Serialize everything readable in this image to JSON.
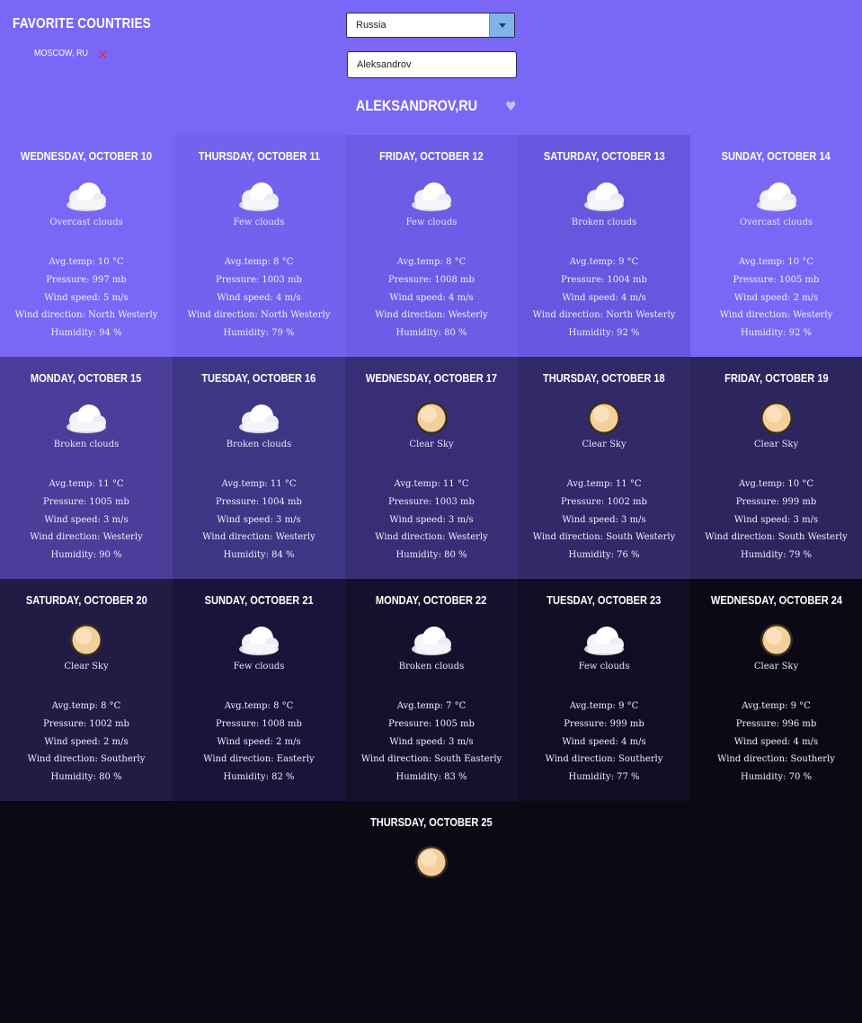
{
  "favorites": {
    "title": "FAVORITE COUNTRIES",
    "items": [
      {
        "label": "MOSCOW, RU",
        "remove": "✕"
      }
    ]
  },
  "search": {
    "country_selected": "Russia",
    "city_value": "Aleksandrov"
  },
  "location": {
    "title": "ALEKSANDROV,RU",
    "heart": "♥"
  },
  "labels": {
    "avg_temp": "Avg.temp:",
    "pressure": "Pressure:",
    "wind_speed": "Wind speed:",
    "wind_direction": "Wind direction:",
    "humidity": "Humidity:"
  },
  "icons": {
    "cloud": "cloud-icon",
    "sun": "clear-sky-icon"
  },
  "colors": {
    "header": "#7b67f6",
    "text": "#ffffff",
    "remove": "#e0245e",
    "dropdown_button": "#7fb3ea"
  },
  "days": [
    {
      "date": "WEDNESDAY, OCTOBER 10",
      "icon": "cloud",
      "desc": "Overcast clouds",
      "temp": "10 °C",
      "pressure": "997 mb",
      "wind_speed": "5 m/s",
      "wind_dir": "North Westerly",
      "humidity": "94 %"
    },
    {
      "date": "THURSDAY, OCTOBER 11",
      "icon": "cloud",
      "desc": "Few clouds",
      "temp": "8 °C",
      "pressure": "1003 mb",
      "wind_speed": "4 m/s",
      "wind_dir": "North Westerly",
      "humidity": "79 %"
    },
    {
      "date": "FRIDAY, OCTOBER 12",
      "icon": "cloud",
      "desc": "Few clouds",
      "temp": "8 °C",
      "pressure": "1008 mb",
      "wind_speed": "4 m/s",
      "wind_dir": "Westerly",
      "humidity": "80 %"
    },
    {
      "date": "SATURDAY, OCTOBER 13",
      "icon": "cloud",
      "desc": "Broken clouds",
      "temp": "9 °C",
      "pressure": "1004 mb",
      "wind_speed": "4 m/s",
      "wind_dir": "North Westerly",
      "humidity": "92 %"
    },
    {
      "date": "SUNDAY, OCTOBER 14",
      "icon": "cloud",
      "desc": "Overcast clouds",
      "temp": "10 °C",
      "pressure": "1005 mb",
      "wind_speed": "2 m/s",
      "wind_dir": "Westerly",
      "humidity": "92 %"
    },
    {
      "date": "MONDAY, OCTOBER 15",
      "icon": "cloud",
      "desc": "Broken clouds",
      "temp": "11 °C",
      "pressure": "1005 mb",
      "wind_speed": "3 m/s",
      "wind_dir": "Westerly",
      "humidity": "90 %"
    },
    {
      "date": "TUESDAY, OCTOBER 16",
      "icon": "cloud",
      "desc": "Broken clouds",
      "temp": "11 °C",
      "pressure": "1004 mb",
      "wind_speed": "3 m/s",
      "wind_dir": "Westerly",
      "humidity": "84 %"
    },
    {
      "date": "WEDNESDAY, OCTOBER 17",
      "icon": "sun",
      "desc": "Clear Sky",
      "temp": "11 °C",
      "pressure": "1003 mb",
      "wind_speed": "3 m/s",
      "wind_dir": "Westerly",
      "humidity": "80 %"
    },
    {
      "date": "THURSDAY, OCTOBER 18",
      "icon": "sun",
      "desc": "Clear Sky",
      "temp": "11 °C",
      "pressure": "1002 mb",
      "wind_speed": "3 m/s",
      "wind_dir": "South Westerly",
      "humidity": "76 %"
    },
    {
      "date": "FRIDAY, OCTOBER 19",
      "icon": "sun",
      "desc": "Clear Sky",
      "temp": "10 °C",
      "pressure": "999 mb",
      "wind_speed": "3 m/s",
      "wind_dir": "South Westerly",
      "humidity": "79 %"
    },
    {
      "date": "SATURDAY, OCTOBER 20",
      "icon": "sun",
      "desc": "Clear Sky",
      "temp": "8 °C",
      "pressure": "1002 mb",
      "wind_speed": "2 m/s",
      "wind_dir": "Southerly",
      "humidity": "80 %"
    },
    {
      "date": "SUNDAY, OCTOBER 21",
      "icon": "cloud",
      "desc": "Few clouds",
      "temp": "8 °C",
      "pressure": "1008 mb",
      "wind_speed": "2 m/s",
      "wind_dir": "Easterly",
      "humidity": "82 %"
    },
    {
      "date": "MONDAY, OCTOBER 22",
      "icon": "cloud",
      "desc": "Broken clouds",
      "temp": "7 °C",
      "pressure": "1005 mb",
      "wind_speed": "3 m/s",
      "wind_dir": "South Easterly",
      "humidity": "83 %"
    },
    {
      "date": "TUESDAY, OCTOBER 23",
      "icon": "cloud",
      "desc": "Few clouds",
      "temp": "9 °C",
      "pressure": "999 mb",
      "wind_speed": "4 m/s",
      "wind_dir": "Southerly",
      "humidity": "77 %"
    },
    {
      "date": "WEDNESDAY, OCTOBER 24",
      "icon": "sun",
      "desc": "Clear Sky",
      "temp": "9 °C",
      "pressure": "996 mb",
      "wind_speed": "4 m/s",
      "wind_dir": "Southerly",
      "humidity": "70 %"
    },
    {
      "date": "THURSDAY, OCTOBER 25",
      "icon": "sun",
      "desc": "",
      "temp": "",
      "pressure": "",
      "wind_speed": "",
      "wind_dir": "",
      "humidity": ""
    }
  ]
}
